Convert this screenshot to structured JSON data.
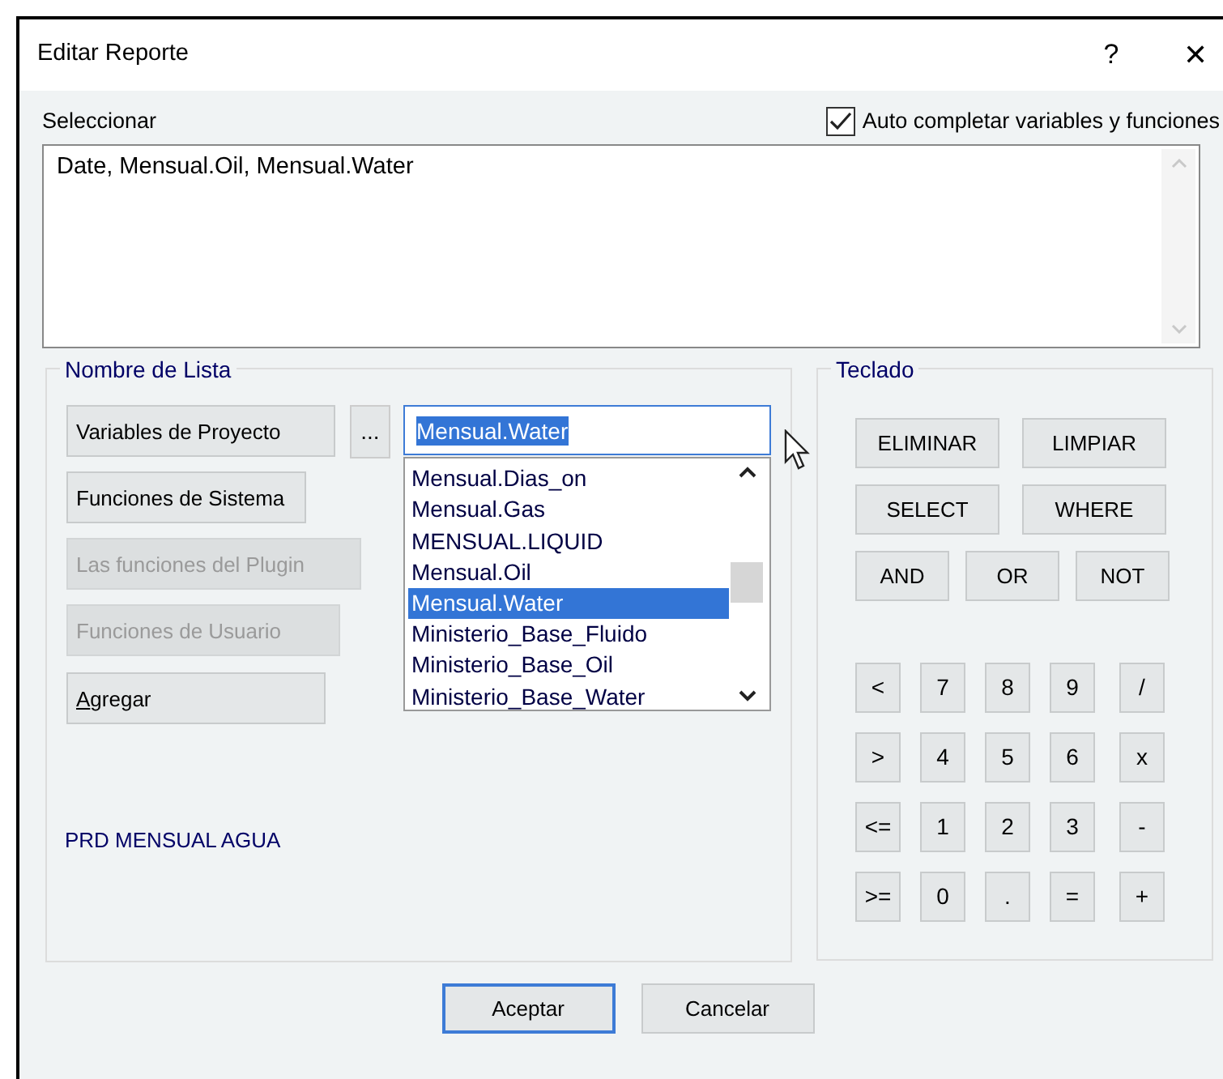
{
  "window": {
    "title": "Editar Reporte",
    "help": "?",
    "close": "✕"
  },
  "select_label": "Seleccionar",
  "autocomplete": {
    "label": "Auto completar variables y funciones",
    "checked": true
  },
  "query": {
    "value": "Date, Mensual.Oil, Mensual.Water"
  },
  "list_group": {
    "title": "Nombre de Lista",
    "buttons": [
      {
        "label": "Variables de Proyecto",
        "disabled": false,
        "underline_first": false
      },
      {
        "label": "Funciones de Sistema",
        "disabled": false,
        "underline_first": false
      },
      {
        "label": "Las funciones del Plugin",
        "disabled": true,
        "underline_first": false
      },
      {
        "label": "Funciones de Usuario",
        "disabled": true,
        "underline_first": false
      },
      {
        "label": "Agregar",
        "disabled": false,
        "underline_first": true
      }
    ],
    "browse_button": "...",
    "combo_value": "Mensual.Water",
    "items": [
      {
        "label": "Mensual.Dias_on",
        "selected": false
      },
      {
        "label": "Mensual.Gas",
        "selected": false
      },
      {
        "label": "MENSUAL.LIQUID",
        "selected": false
      },
      {
        "label": "Mensual.Oil",
        "selected": false
      },
      {
        "label": "Mensual.Water",
        "selected": true
      },
      {
        "label": "Ministerio_Base_Fluido",
        "selected": false
      },
      {
        "label": "Ministerio_Base_Oil",
        "selected": false
      },
      {
        "label": "Ministerio_Base_Water",
        "selected": false
      }
    ],
    "description": "PRD MENSUAL AGUA"
  },
  "keypad": {
    "title": "Teclado",
    "word_rows": [
      [
        "ELIMINAR",
        "LIMPIAR"
      ],
      [
        "SELECT",
        "WHERE"
      ],
      [
        "AND",
        "OR",
        "NOT"
      ]
    ],
    "key_rows": [
      [
        "<",
        "7",
        "8",
        "9",
        "/"
      ],
      [
        ">",
        "4",
        "5",
        "6",
        "x"
      ],
      [
        "<=",
        "1",
        "2",
        "3",
        "-"
      ],
      [
        ">=",
        "0",
        ".",
        "=",
        "+"
      ]
    ]
  },
  "buttons": [
    {
      "label": "Aceptar",
      "default": true
    },
    {
      "label": "Cancelar",
      "default": false
    }
  ]
}
